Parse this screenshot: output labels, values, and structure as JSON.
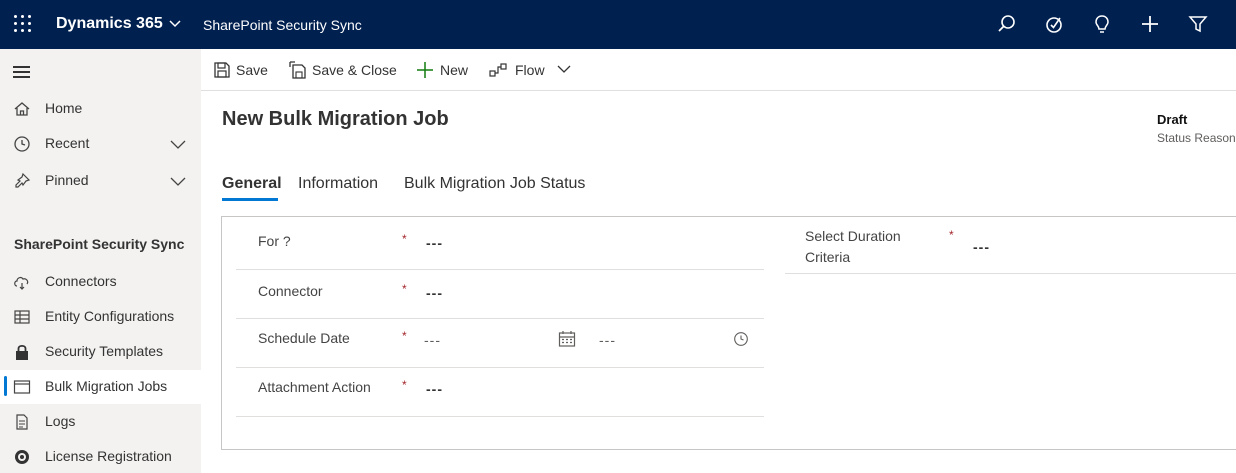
{
  "topbar": {
    "brand": "Dynamics 365",
    "app_name": "SharePoint Security Sync",
    "icons": [
      "search-icon",
      "assistant-icon",
      "lightbulb-icon",
      "plus-icon",
      "filter-icon"
    ]
  },
  "sidebar": {
    "items": [
      {
        "label": "Home",
        "icon": "home-icon"
      },
      {
        "label": "Recent",
        "icon": "clock-icon"
      },
      {
        "label": "Pinned",
        "icon": "pin-icon"
      }
    ],
    "group_title": "SharePoint Security Sync",
    "group_items": [
      {
        "label": "Connectors",
        "icon": "cloud-sync-icon"
      },
      {
        "label": "Entity Configurations",
        "icon": "table-icon"
      },
      {
        "label": "Security Templates",
        "icon": "lock-icon"
      },
      {
        "label": "Bulk Migration Jobs",
        "icon": "window-icon"
      },
      {
        "label": "Logs",
        "icon": "document-icon"
      },
      {
        "label": "License Registration",
        "icon": "badge-icon"
      }
    ]
  },
  "commands": {
    "save": "Save",
    "save_close": "Save & Close",
    "new": "New",
    "flow": "Flow"
  },
  "form": {
    "title": "New Bulk Migration Job",
    "header_field": {
      "value": "Draft",
      "label": "Status Reason"
    },
    "tabs": [
      "General",
      "Information",
      "Bulk Migration Job Status"
    ],
    "fields": {
      "for": {
        "label": "For ?",
        "value": "---"
      },
      "connector": {
        "label": "Connector",
        "value": "---"
      },
      "schedule_date": {
        "label": "Schedule Date",
        "date": "---",
        "time": "---"
      },
      "attachment_action": {
        "label": "Attachment Action",
        "value": "---"
      },
      "duration_criteria": {
        "label_line1": "Select Duration",
        "label_line2": "Criteria",
        "value": "---"
      }
    },
    "required_marker": "*"
  },
  "colors": {
    "topbar_bg": "#002050",
    "accent": "#0078d4",
    "required": "#a4262c",
    "sidebar_bg": "#f3f2f1"
  }
}
